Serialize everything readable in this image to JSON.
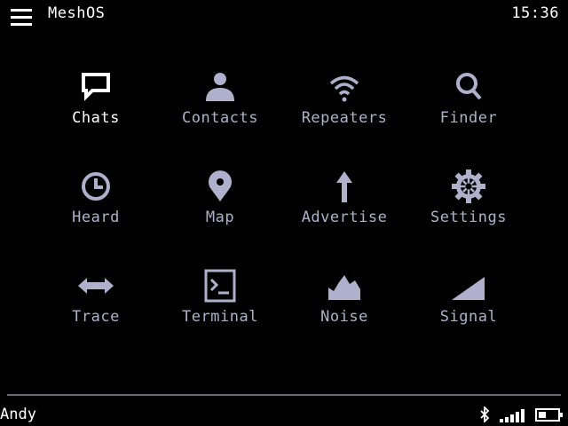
{
  "header": {
    "title": "MeshOS",
    "time": "15:36"
  },
  "apps": [
    {
      "label": "Chats",
      "icon": "chat-bubble-icon"
    },
    {
      "label": "Contacts",
      "icon": "person-icon"
    },
    {
      "label": "Repeaters",
      "icon": "wifi-icon"
    },
    {
      "label": "Finder",
      "icon": "magnifier-icon"
    },
    {
      "label": "Heard",
      "icon": "clock-icon"
    },
    {
      "label": "Map",
      "icon": "map-pin-icon"
    },
    {
      "label": "Advertise",
      "icon": "up-arrow-icon"
    },
    {
      "label": "Settings",
      "icon": "gear-icon"
    },
    {
      "label": "Trace",
      "icon": "double-arrow-icon"
    },
    {
      "label": "Terminal",
      "icon": "terminal-icon"
    },
    {
      "label": "Noise",
      "icon": "noise-peaks-icon"
    },
    {
      "label": "Signal",
      "icon": "signal-ramp-icon"
    }
  ],
  "status": {
    "user": "Andy",
    "icons": [
      "bluetooth-icon",
      "signal-bars-icon",
      "battery-icon"
    ]
  },
  "colors": {
    "background": "#000000",
    "label": "#aeb0cc",
    "active": "#ffffff",
    "icon": "#aeb0cc",
    "divider": "#6a6a78"
  }
}
